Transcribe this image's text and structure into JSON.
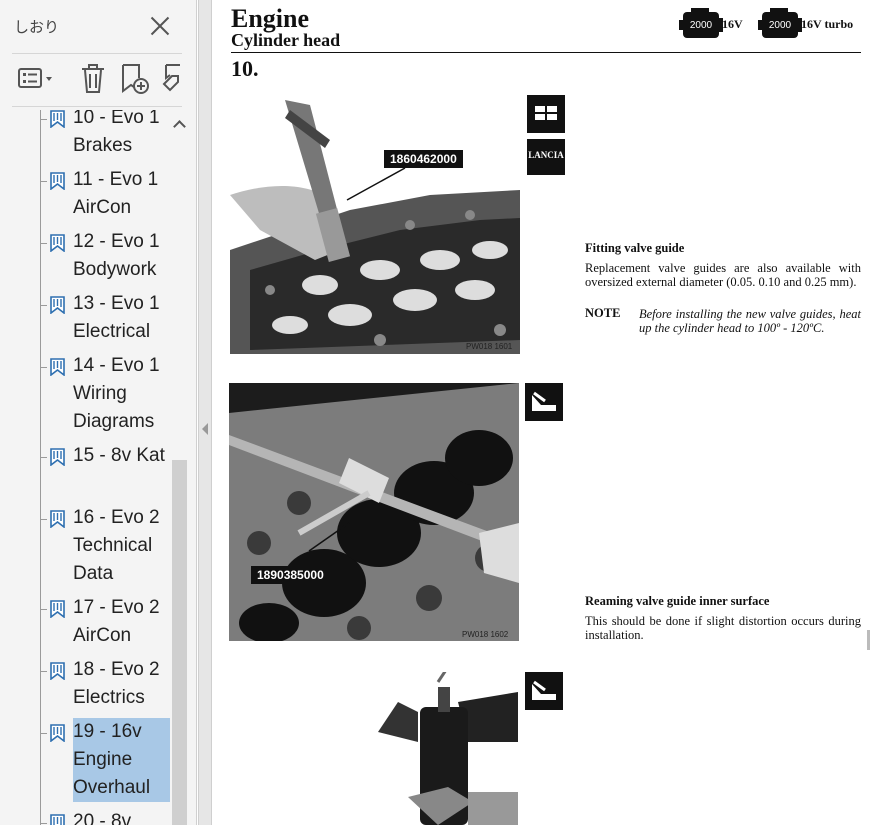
{
  "sidebar": {
    "title": "しおり",
    "toolbar": {
      "options": "options-icon",
      "delete": "trash-icon",
      "add": "add-bookmark-icon",
      "tag": "tag-bookmark-icon"
    },
    "bookmarks": [
      {
        "label": "10 - Evo 1 Brakes"
      },
      {
        "label": "11 - Evo 1 AirCon"
      },
      {
        "label": "12 - Evo 1 Bodywork"
      },
      {
        "label": "13 - Evo 1 Electrical"
      },
      {
        "label": "14 - Evo 1 Wiring Diagrams"
      },
      {
        "label": "15 - 8v Kat"
      },
      {
        "label": "16 - Evo 2 Technical Data"
      },
      {
        "label": "17 - Evo 2 AirCon"
      },
      {
        "label": "18 - Evo 2 Electrics"
      },
      {
        "label": "19 - 16v Engine Overhaul",
        "selected": true
      },
      {
        "label": "20 - 8v"
      }
    ]
  },
  "document": {
    "title": "Engine",
    "subtitle": "Cylinder head",
    "section_number": "10.",
    "engine_badges": [
      {
        "label": "2000",
        "suffix": "16V"
      },
      {
        "label": "2000",
        "suffix": "16V turbo"
      }
    ],
    "figure1": {
      "callout": "1860462000",
      "code": "PW018 1601"
    },
    "figure2": {
      "callout": "1890385000",
      "code": "PW018 1602"
    },
    "icon_lancia": "LANCIA",
    "section1": {
      "title": "Fitting valve guide",
      "body": "Replacement valve guides are also available with oversized external diameter (0.05. 0.10 and 0.25 mm).",
      "note_label": "NOTE",
      "note": "Before installing the new valve guides, heat up the cylinder head to 100º - 120ºC."
    },
    "section2": {
      "title": "Reaming valve guide inner surface",
      "body": "This should be done if slight distortion occurs during installation."
    }
  }
}
